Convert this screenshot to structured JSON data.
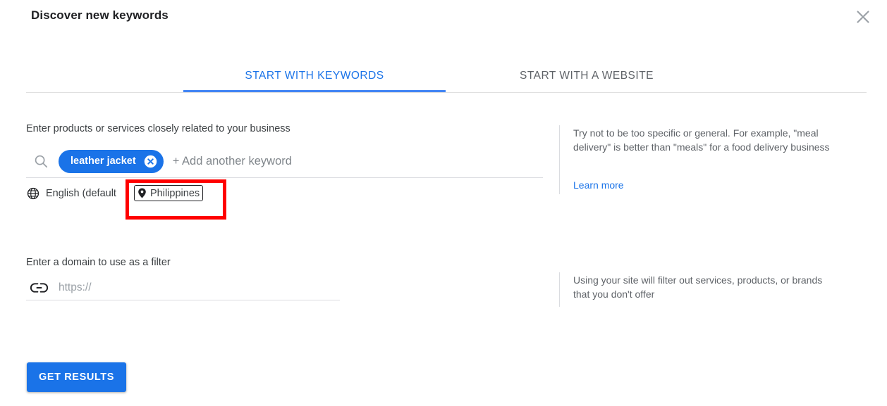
{
  "header": {
    "title": "Discover new keywords",
    "close_icon": "close-icon"
  },
  "tabs": [
    {
      "id": "keywords",
      "label": "START WITH KEYWORDS",
      "active": true
    },
    {
      "id": "website",
      "label": "START WITH A WEBSITE",
      "active": false
    }
  ],
  "keyword_section": {
    "label": "Enter products or services closely related to your business",
    "search_icon": "search-icon",
    "chips": [
      {
        "label": "leather jacket",
        "remove_icon": "close-circle-icon"
      }
    ],
    "add_placeholder": "+ Add another keyword",
    "language": {
      "icon": "globe-icon",
      "label": "English (default"
    },
    "location": {
      "icon": "location-pin-icon",
      "label": "Philippines"
    }
  },
  "domain_section": {
    "label": "Enter a domain to use as a filter",
    "icon": "link-icon",
    "placeholder": "https://",
    "value": ""
  },
  "helpers": {
    "keywords_hint": "Try not to be too specific or general. For example, \"meal delivery\" is better than \"meals\" for a food delivery business",
    "learn_more": "Learn more",
    "domain_hint": "Using your site will filter out services, products, or brands that you don't offer"
  },
  "actions": {
    "get_results": "GET RESULTS"
  },
  "colors": {
    "accent_blue": "#1a73e8",
    "tab_underline": "#4285f4",
    "annotation_red": "#ff0000",
    "muted_text": "#5f6368"
  }
}
